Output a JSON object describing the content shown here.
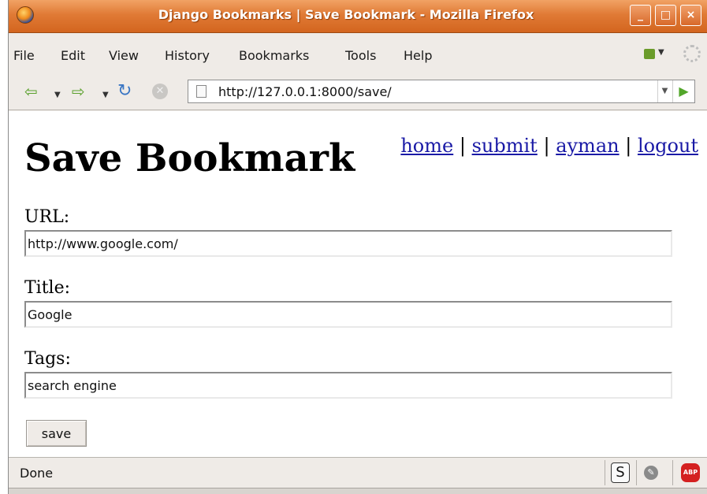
{
  "window": {
    "title": "Django Bookmarks | Save Bookmark - Mozilla Firefox",
    "minimize_label": "_",
    "maximize_label": "□",
    "close_label": "×"
  },
  "menu": {
    "file": "File",
    "edit": "Edit",
    "view": "View",
    "history": "History",
    "bookmarks": "Bookmarks",
    "tools": "Tools",
    "help": "Help"
  },
  "nav": {
    "url": "http://127.0.0.1:8000/save/",
    "icons": [
      "back-arrow-icon",
      "forward-arrow-icon",
      "reload-icon",
      "stop-icon",
      "page-icon",
      "go-icon"
    ]
  },
  "page": {
    "heading": "Save Bookmark",
    "links": {
      "home": "home",
      "submit": "submit",
      "user": "ayman",
      "logout": "logout",
      "separator": "|"
    },
    "form": {
      "url_label": "URL:",
      "url_value": "http://www.google.com/",
      "title_label": "Title:",
      "title_value": "Google",
      "tags_label": "Tags:",
      "tags_value": "search engine",
      "submit_label": "save"
    }
  },
  "status": {
    "text": "Done",
    "s_icon_glyph": "S",
    "abp_label": "ABP"
  },
  "colors": {
    "titlebar": "#e07a35",
    "link": "#1a1aa6",
    "chrome": "#efebe7"
  }
}
